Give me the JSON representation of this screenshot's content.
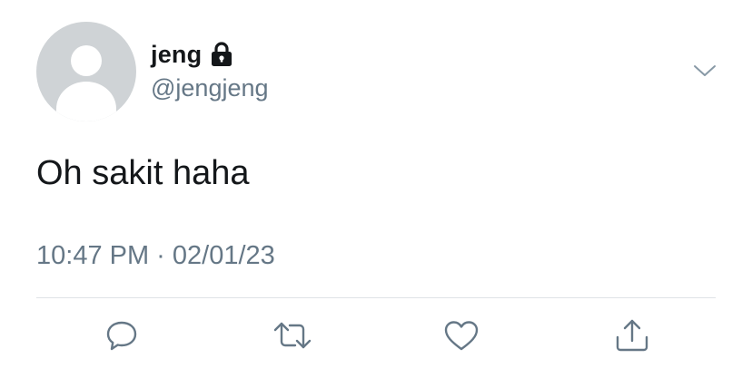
{
  "tweet": {
    "display_name": "jeng",
    "handle": "@jengjeng",
    "protected_icon": "lock-icon",
    "text": "Oh sakit haha",
    "timestamp": "10:47 PM · 02/01/23"
  },
  "actions": {
    "reply_icon": "reply-icon",
    "retweet_icon": "retweet-icon",
    "like_icon": "heart-icon",
    "share_icon": "share-icon",
    "more_icon": "chevron-down-icon"
  },
  "colors": {
    "primary_text": "#14171a",
    "secondary_text": "#657786",
    "icon": "#657786",
    "avatar_bg": "#cfd3d6",
    "divider": "#dfe3e6"
  }
}
